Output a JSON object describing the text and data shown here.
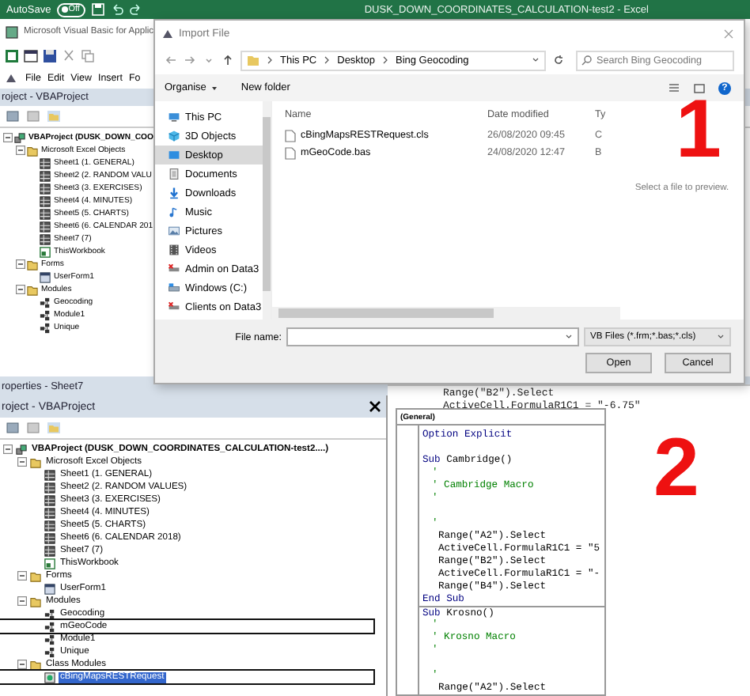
{
  "excel_bar": {
    "autosave": "AutoSave",
    "toggle": "Off",
    "title": "DUSK_DOWN_COORDINATES_CALCULATION-test2  -  Excel"
  },
  "vbe_top": {
    "title": "Microsoft Visual Basic for Applic",
    "menu": [
      "File",
      "Edit",
      "View",
      "Insert",
      "Fo"
    ],
    "pane_title": "roject - VBAProject",
    "properties_title": "roperties - Sheet7",
    "tree": [
      {
        "label": "VBAProject (DUSK_DOWN_COO",
        "kind": "project",
        "expanded": true,
        "children": [
          {
            "label": "Microsoft Excel Objects",
            "kind": "folder",
            "expanded": true,
            "children": [
              {
                "label": "Sheet1 (1. GENERAL)",
                "kind": "sheet"
              },
              {
                "label": "Sheet2 (2. RANDOM VALU",
                "kind": "sheet"
              },
              {
                "label": "Sheet3 (3. EXERCISES)",
                "kind": "sheet"
              },
              {
                "label": "Sheet4 (4. MINUTES)",
                "kind": "sheet"
              },
              {
                "label": "Sheet5 (5. CHARTS)",
                "kind": "sheet"
              },
              {
                "label": "Sheet6 (6. CALENDAR 201",
                "kind": "sheet"
              },
              {
                "label": "Sheet7 (7)",
                "kind": "sheet"
              },
              {
                "label": "ThisWorkbook",
                "kind": "workbook"
              }
            ]
          },
          {
            "label": "Forms",
            "kind": "folder",
            "expanded": true,
            "children": [
              {
                "label": "UserForm1",
                "kind": "form"
              }
            ]
          },
          {
            "label": "Modules",
            "kind": "folder",
            "expanded": true,
            "children": [
              {
                "label": "Geocoding",
                "kind": "module"
              },
              {
                "label": "Module1",
                "kind": "module"
              },
              {
                "label": "Unique",
                "kind": "module"
              }
            ]
          }
        ]
      }
    ]
  },
  "dialog": {
    "title": "Import File",
    "breadcrumb": [
      "This PC",
      "Desktop",
      "Bing Geocoding"
    ],
    "search": {
      "placeholder": "Search Bing Geocoding"
    },
    "toolbar": [
      "Organise",
      "New folder"
    ],
    "help": "?",
    "nav": [
      {
        "label": "This PC",
        "kind": "pc",
        "selected": false
      },
      {
        "label": "3D Objects",
        "kind": "cube",
        "selected": false
      },
      {
        "label": "Desktop",
        "kind": "desktop",
        "selected": true
      },
      {
        "label": "Documents",
        "kind": "documents",
        "selected": false
      },
      {
        "label": "Downloads",
        "kind": "downloads",
        "selected": false
      },
      {
        "label": "Music",
        "kind": "music",
        "selected": false
      },
      {
        "label": "Pictures",
        "kind": "pictures",
        "selected": false
      },
      {
        "label": "Videos",
        "kind": "videos",
        "selected": false
      },
      {
        "label": "Admin on Data3",
        "kind": "netdrive",
        "selected": false
      },
      {
        "label": "Windows (C:)",
        "kind": "drive",
        "selected": false
      },
      {
        "label": "Clients on Data3",
        "kind": "netdrive",
        "selected": false
      }
    ],
    "columns": [
      "Name",
      "Date modified",
      "Ty"
    ],
    "files": [
      {
        "name": "cBingMapsRESTRequest.cls",
        "date": "26/08/2020 09:45",
        "type": "C"
      },
      {
        "name": "mGeoCode.bas",
        "date": "24/08/2020 12:47",
        "type": "B"
      }
    ],
    "preview": "Select a file to preview.",
    "file_name_label": "File name:",
    "filter": "VB Files (*.frm;*.bas;*.cls)",
    "buttons": [
      "Open",
      "Cancel"
    ]
  },
  "markers": [
    "1",
    "2"
  ],
  "vbe_bottom": {
    "pane_title": "roject - VBAProject",
    "tree": [
      {
        "label": "VBAProject (DUSK_DOWN_COORDINATES_CALCULATION-test2....)",
        "kind": "project",
        "expanded": true,
        "selected": false,
        "outlined": false,
        "children": [
          {
            "label": "Microsoft Excel Objects",
            "kind": "folder",
            "expanded": true,
            "selected": false,
            "outlined": false,
            "children": [
              {
                "label": "Sheet1 (1. GENERAL)",
                "kind": "sheet",
                "selected": false,
                "outlined": false
              },
              {
                "label": "Sheet2 (2. RANDOM VALUES)",
                "kind": "sheet",
                "selected": false,
                "outlined": false
              },
              {
                "label": "Sheet3 (3. EXERCISES)",
                "kind": "sheet",
                "selected": false,
                "outlined": false
              },
              {
                "label": "Sheet4 (4. MINUTES)",
                "kind": "sheet",
                "selected": false,
                "outlined": false
              },
              {
                "label": "Sheet5 (5. CHARTS)",
                "kind": "sheet",
                "selected": false,
                "outlined": false
              },
              {
                "label": "Sheet6 (6. CALENDAR 2018)",
                "kind": "sheet",
                "selected": false,
                "outlined": false
              },
              {
                "label": "Sheet7 (7)",
                "kind": "sheet",
                "selected": false,
                "outlined": false
              },
              {
                "label": "ThisWorkbook",
                "kind": "workbook",
                "selected": false,
                "outlined": false
              }
            ]
          },
          {
            "label": "Forms",
            "kind": "folder",
            "expanded": true,
            "selected": false,
            "outlined": false,
            "children": [
              {
                "label": "UserForm1",
                "kind": "form",
                "selected": false,
                "outlined": false
              }
            ]
          },
          {
            "label": "Modules",
            "kind": "folder",
            "expanded": true,
            "selected": false,
            "outlined": false,
            "children": [
              {
                "label": "Geocoding",
                "kind": "module",
                "selected": false,
                "outlined": false
              },
              {
                "label": "mGeoCode",
                "kind": "module",
                "selected": false,
                "outlined": true
              },
              {
                "label": "Module1",
                "kind": "module",
                "selected": false,
                "outlined": false
              },
              {
                "label": "Unique",
                "kind": "module",
                "selected": false,
                "outlined": false
              }
            ]
          },
          {
            "label": "Class Modules",
            "kind": "folder",
            "expanded": true,
            "selected": false,
            "outlined": false,
            "children": [
              {
                "label": "cBingMapsRESTRequest",
                "kind": "class",
                "selected": true,
                "outlined": true
              }
            ]
          }
        ]
      }
    ]
  },
  "code_behind": [
    "Range(\"B2\").Select",
    "ActiveCell.FormulaR1C1 = \"-6.75\""
  ],
  "code_window": {
    "object": "(General)",
    "lines": [
      {
        "kind": "keyword",
        "text": "Option Explicit"
      },
      {
        "kind": "blank"
      },
      {
        "kind": "keyword",
        "text": "Sub",
        "rest": "Cambridge()"
      },
      {
        "kind": "comment",
        "text": "'"
      },
      {
        "kind": "comment",
        "text": "' Cambridge Macro"
      },
      {
        "kind": "comment",
        "text": "'"
      },
      {
        "kind": "blank"
      },
      {
        "kind": "comment",
        "text": "'"
      },
      {
        "kind": "code",
        "indent": true,
        "text": "Range(\"A2\").Select"
      },
      {
        "kind": "code",
        "indent": true,
        "text": "ActiveCell.FormulaR1C1 = \"5"
      },
      {
        "kind": "code",
        "indent": true,
        "text": "Range(\"B2\").Select"
      },
      {
        "kind": "code",
        "indent": true,
        "text": "ActiveCell.FormulaR1C1 = \"-"
      },
      {
        "kind": "code",
        "indent": true,
        "text": "Range(\"B4\").Select"
      },
      {
        "kind": "keyword",
        "text": "End Sub"
      },
      {
        "kind": "keyword",
        "text": "Sub",
        "rest": "Krosno()",
        "divider": true
      },
      {
        "kind": "comment",
        "text": "'"
      },
      {
        "kind": "comment",
        "text": "' Krosno Macro"
      },
      {
        "kind": "comment",
        "text": "'"
      },
      {
        "kind": "blank"
      },
      {
        "kind": "comment",
        "text": "'"
      },
      {
        "kind": "code",
        "indent": true,
        "text": "Range(\"A2\").Select"
      }
    ]
  }
}
